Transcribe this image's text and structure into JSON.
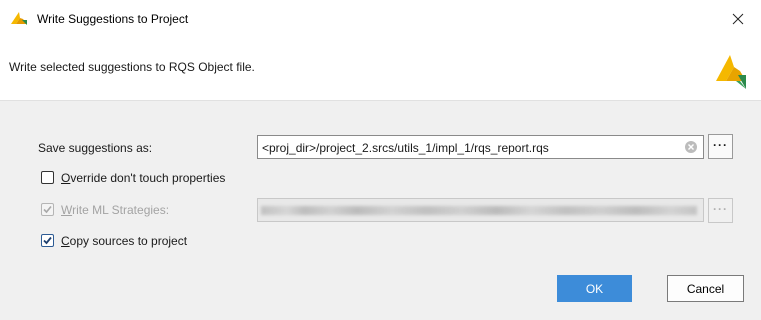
{
  "window": {
    "title": "Write Suggestions to Project",
    "logo_icon": "vivado-logo-icon",
    "close_icon": "close-icon"
  },
  "header": {
    "description": "Write selected suggestions to RQS Object file."
  },
  "form": {
    "save_as": {
      "label": "Save suggestions as:",
      "value": "<proj_dir>/project_2.srcs/utils_1/impl_1/rqs_report.rqs",
      "clear_icon": "clear-icon",
      "browse_label": "···"
    },
    "override": {
      "label_first": "O",
      "label_rest": "verride don't touch properties",
      "checked": false
    },
    "ml_strategies": {
      "label_first": "W",
      "label_rest": "rite ML Strategies:",
      "checked": true,
      "enabled": false,
      "browse_label": "···"
    },
    "copy_sources": {
      "label_first": "C",
      "label_rest": "opy sources to project",
      "checked": true
    }
  },
  "buttons": {
    "ok": "OK",
    "cancel": "Cancel"
  },
  "colors": {
    "accent": "#3d8cd9",
    "logo_yellow": "#f5b800",
    "logo_green": "#2b8a4c"
  }
}
